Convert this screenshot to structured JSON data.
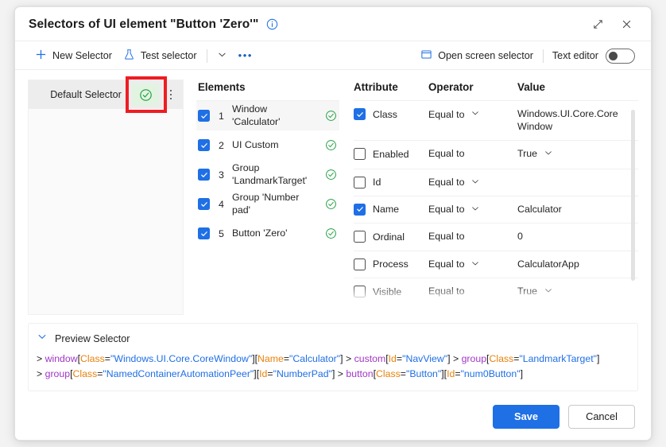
{
  "window": {
    "title": "Selectors of UI element \"Button 'Zero'\"",
    "info_icon": "info-circle-icon",
    "restore_icon": "restore-diagonal-icon",
    "close_icon": "close-icon"
  },
  "toolbar": {
    "new_selector": "New Selector",
    "new_selector_icon": "plus-icon",
    "test_selector": "Test selector",
    "test_selector_icon": "flask-icon",
    "chevron_icon": "chevron-down-icon",
    "overflow_icon": "ellipsis-icon",
    "open_screen_selector": "Open screen selector",
    "open_screen_selector_icon": "window-rectangle-icon",
    "text_editor": "Text editor",
    "text_editor_state": "off"
  },
  "selector_panel": {
    "name": "Default Selector",
    "status_icon": "check-circle-icon",
    "kebab_icon": "more-vertical-icon",
    "highlight_color": "#ef1c21"
  },
  "elements": {
    "title": "Elements",
    "items": [
      {
        "index": "1",
        "label": "Window 'Calculator'",
        "checked": true,
        "status": "valid",
        "selected": true
      },
      {
        "index": "2",
        "label": "UI Custom",
        "checked": true,
        "status": "valid",
        "selected": false
      },
      {
        "index": "3",
        "label": "Group 'LandmarkTarget'",
        "checked": true,
        "status": "valid",
        "selected": false
      },
      {
        "index": "4",
        "label": "Group 'Number pad'",
        "checked": true,
        "status": "valid",
        "selected": false
      },
      {
        "index": "5",
        "label": "Button 'Zero'",
        "checked": true,
        "status": "valid",
        "selected": false
      }
    ]
  },
  "attributes": {
    "headers": {
      "attribute": "Attribute",
      "operator": "Operator",
      "value": "Value"
    },
    "rows": [
      {
        "checked": true,
        "name": "Class",
        "operator": "Equal to",
        "op_chevron": true,
        "value": "Windows.UI.Core.CoreWindow",
        "val_chevron": false
      },
      {
        "checked": false,
        "name": "Enabled",
        "operator": "Equal to",
        "op_chevron": false,
        "value": "True",
        "val_chevron": true
      },
      {
        "checked": false,
        "name": "Id",
        "operator": "Equal to",
        "op_chevron": true,
        "value": "",
        "val_chevron": false
      },
      {
        "checked": true,
        "name": "Name",
        "operator": "Equal to",
        "op_chevron": true,
        "value": "Calculator",
        "val_chevron": false
      },
      {
        "checked": false,
        "name": "Ordinal",
        "operator": "Equal to",
        "op_chevron": false,
        "value": "0",
        "val_chevron": false
      },
      {
        "checked": false,
        "name": "Process",
        "operator": "Equal to",
        "op_chevron": true,
        "value": "CalculatorApp",
        "val_chevron": false
      },
      {
        "checked": false,
        "name": "Visible",
        "operator": "Equal to",
        "op_chevron": false,
        "value": "True",
        "val_chevron": true
      }
    ]
  },
  "preview": {
    "label": "Preview Selector",
    "chevron_icon": "chevron-down-icon",
    "line1": {
      "gt1": ">",
      "tag1": "window",
      "a1": "Class",
      "v1": "\"Windows.UI.Core.CoreWindow\"",
      "a2": "Name",
      "v2": "\"Calculator\"",
      "gt2": ">",
      "tag2": "custom",
      "a3": "Id",
      "v3": "\"NavView\"",
      "gt3": ">",
      "tag3": "group",
      "a4": "Class",
      "v4": "\"LandmarkTarget\""
    },
    "line2": {
      "gt1": ">",
      "tag1": "group",
      "a1": "Class",
      "v1": "\"NamedContainerAutomationPeer\"",
      "a2": "Id",
      "v2": "\"NumberPad\"",
      "gt2": ">",
      "tag2": "button",
      "a3": "Class",
      "v3": "\"Button\"",
      "a4": "Id",
      "v4": "\"num0Button\""
    }
  },
  "footer": {
    "save": "Save",
    "cancel": "Cancel"
  },
  "colors": {
    "accent": "#1f6fe5",
    "valid_green": "#1e9e3e",
    "highlight_red": "#ef1c21",
    "token_tag": "#a135c6",
    "token_attr": "#e8820c",
    "token_string": "#1f6fe5"
  }
}
